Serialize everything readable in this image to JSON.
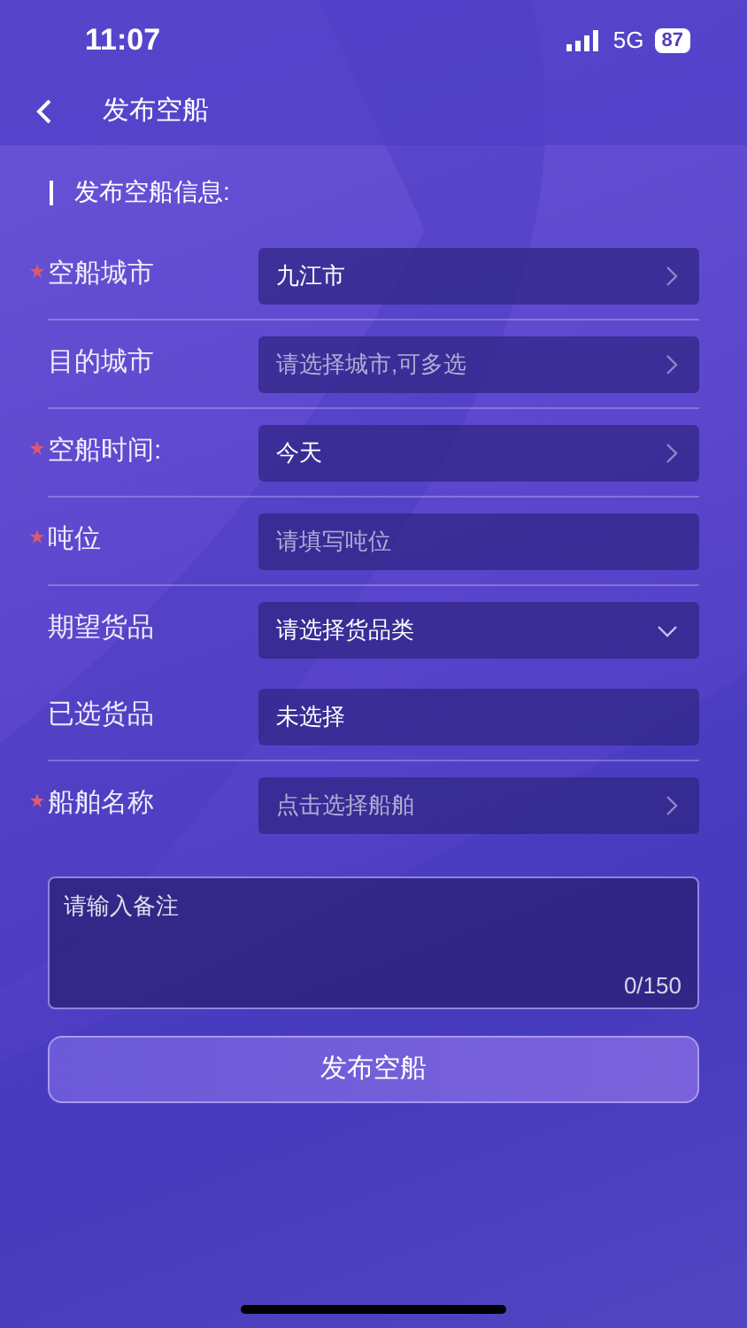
{
  "status_bar": {
    "time": "11:07",
    "network": "5G",
    "battery": "87"
  },
  "header": {
    "title": "发布空船"
  },
  "section_title": "发布空船信息:",
  "rows": [
    {
      "label": "空船城市",
      "required": true,
      "value": "九江市",
      "kind": "picker",
      "divider": true
    },
    {
      "label": "目的城市",
      "required": false,
      "placeholder": "请选择城市,可多选",
      "kind": "picker",
      "divider": true
    },
    {
      "label": "空船时间:",
      "required": true,
      "value": "今天",
      "kind": "picker",
      "divider": true
    },
    {
      "label": "吨位",
      "required": true,
      "placeholder": "请填写吨位",
      "kind": "input",
      "divider": true
    },
    {
      "label": "期望货品",
      "required": false,
      "value": "请选择货品类",
      "kind": "dropdown",
      "divider": false
    },
    {
      "label": "已选货品",
      "required": false,
      "value": "未选择",
      "kind": "input",
      "divider": true
    },
    {
      "label": "船舶名称",
      "required": true,
      "placeholder": "点击选择船舶",
      "kind": "picker",
      "divider": false
    }
  ],
  "remark": {
    "placeholder": "请输入备注",
    "counter": "0/150"
  },
  "submit_button": "发布空船"
}
